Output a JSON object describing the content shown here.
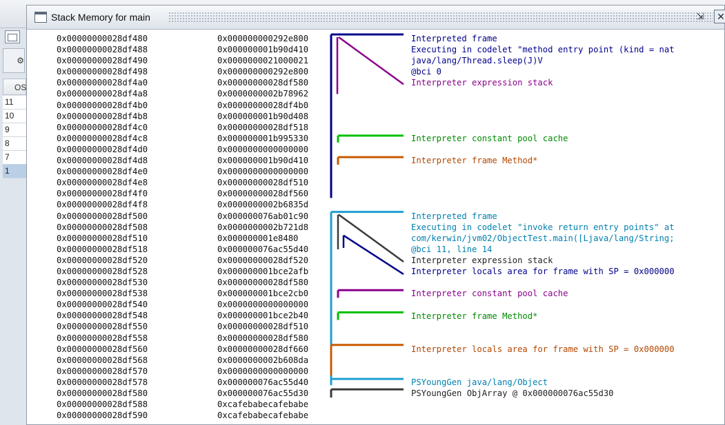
{
  "window": {
    "title": "Stack Memory for main",
    "minimize_icon": "restore-icon",
    "close_icon": "close-icon"
  },
  "background": {
    "column_header": "OS",
    "rows": [
      {
        "label": "11"
      },
      {
        "label": "10"
      },
      {
        "label": "9"
      },
      {
        "label": "8"
      },
      {
        "label": "7"
      },
      {
        "label": "1",
        "selected": true
      }
    ]
  },
  "memory_rows": [
    {
      "address": "0x00000000028df480",
      "value": "0x000000000292e800"
    },
    {
      "address": "0x00000000028df488",
      "value": "0x000000001b90d410"
    },
    {
      "address": "0x00000000028df490",
      "value": "0x0000000021000021"
    },
    {
      "address": "0x00000000028df498",
      "value": "0x000000000292e800"
    },
    {
      "address": "0x00000000028df4a0",
      "value": "0x00000000028df580"
    },
    {
      "address": "0x00000000028df4a8",
      "value": "0x0000000002b78962"
    },
    {
      "address": "0x00000000028df4b0",
      "value": "0x00000000028df4b0"
    },
    {
      "address": "0x00000000028df4b8",
      "value": "0x000000001b90d408"
    },
    {
      "address": "0x00000000028df4c0",
      "value": "0x00000000028df518"
    },
    {
      "address": "0x00000000028df4c8",
      "value": "0x000000001b995330"
    },
    {
      "address": "0x00000000028df4d0",
      "value": "0x0000000000000000"
    },
    {
      "address": "0x00000000028df4d8",
      "value": "0x000000001b90d410"
    },
    {
      "address": "0x00000000028df4e0",
      "value": "0x0000000000000000"
    },
    {
      "address": "0x00000000028df4e8",
      "value": "0x00000000028df510"
    },
    {
      "address": "0x00000000028df4f0",
      "value": "0x00000000028df560"
    },
    {
      "address": "0x00000000028df4f8",
      "value": "0x0000000002b6835d"
    },
    {
      "address": "0x00000000028df500",
      "value": "0x000000076ab01c90"
    },
    {
      "address": "0x00000000028df508",
      "value": "0x0000000002b721d8"
    },
    {
      "address": "0x00000000028df510",
      "value": "0x000000001e8480"
    },
    {
      "address": "0x00000000028df518",
      "value": "0x000000076ac55d40"
    },
    {
      "address": "0x00000000028df520",
      "value": "0x00000000028df520"
    },
    {
      "address": "0x00000000028df528",
      "value": "0x000000001bce2afb"
    },
    {
      "address": "0x00000000028df530",
      "value": "0x00000000028df580"
    },
    {
      "address": "0x00000000028df538",
      "value": "0x000000001bce2cb0"
    },
    {
      "address": "0x00000000028df540",
      "value": "0x0000000000000000"
    },
    {
      "address": "0x00000000028df548",
      "value": "0x000000001bce2b40"
    },
    {
      "address": "0x00000000028df550",
      "value": "0x00000000028df510"
    },
    {
      "address": "0x00000000028df558",
      "value": "0x00000000028df580"
    },
    {
      "address": "0x00000000028df560",
      "value": "0x00000000028df660"
    },
    {
      "address": "0x00000000028df568",
      "value": "0x0000000002b608da"
    },
    {
      "address": "0x00000000028df570",
      "value": "0x0000000000000000"
    },
    {
      "address": "0x00000000028df578",
      "value": "0x000000076ac55d40"
    },
    {
      "address": "0x00000000028df580",
      "value": "0x000000076ac55d30"
    },
    {
      "address": "0x00000000028df588",
      "value": "0xcafebabecafebabe"
    },
    {
      "address": "0x00000000028df590",
      "value": "0xcafebabecafebabe"
    }
  ],
  "annotations": [
    {
      "row": 0,
      "text": "Interpreted frame",
      "color": "#00008b"
    },
    {
      "row": 1,
      "text": "Executing in codelet \"method entry point (kind = nat",
      "color": "#00008b"
    },
    {
      "row": 2,
      "text": "java/lang/Thread.sleep(J)V",
      "color": "#00008b"
    },
    {
      "row": 3,
      "text": "@bci 0",
      "color": "#00008b"
    },
    {
      "row": 4,
      "text": "Interpreter expression stack",
      "color": "#8b008b"
    },
    {
      "row": 9,
      "text": "Interpreter constant pool cache",
      "color": "#008b00"
    },
    {
      "row": 11,
      "text": "Interpreter frame Method*",
      "color": "#b34700"
    },
    {
      "row": 16,
      "text": "Interpreted frame",
      "color": "#0080b0"
    },
    {
      "row": 17,
      "text": "Executing in codelet \"invoke return entry points\" at",
      "color": "#0080b0"
    },
    {
      "row": 18,
      "text": "com/kerwin/jvm02/ObjectTest.main([Ljava/lang/String;",
      "color": "#0080b0"
    },
    {
      "row": 19,
      "text": "@bci 11, line 14",
      "color": "#0080b0"
    },
    {
      "row": 20,
      "text": "Interpreter expression stack",
      "color": "#222222"
    },
    {
      "row": 21,
      "text": "Interpreter locals area for frame with SP = 0x000000",
      "color": "#00008b"
    },
    {
      "row": 23,
      "text": "Interpreter constant pool cache",
      "color": "#8b008b"
    },
    {
      "row": 25,
      "text": "Interpreter frame Method*",
      "color": "#008b00"
    },
    {
      "row": 28,
      "text": "Interpreter locals area for frame with SP = 0x000000",
      "color": "#b34700"
    },
    {
      "row": 31,
      "text": "PSYoungGen java/lang/Object",
      "color": "#0080b0"
    },
    {
      "row": 32,
      "text": "PSYoungGen ObjArray @ 0x000000076ac55d30",
      "color": "#222222"
    }
  ],
  "colors": {
    "navy": "#00008b",
    "purple": "#8b008b",
    "green": "#00c000",
    "orange": "#c85a00",
    "cyan": "#1f9fd0",
    "dark": "#3a3a3a"
  }
}
